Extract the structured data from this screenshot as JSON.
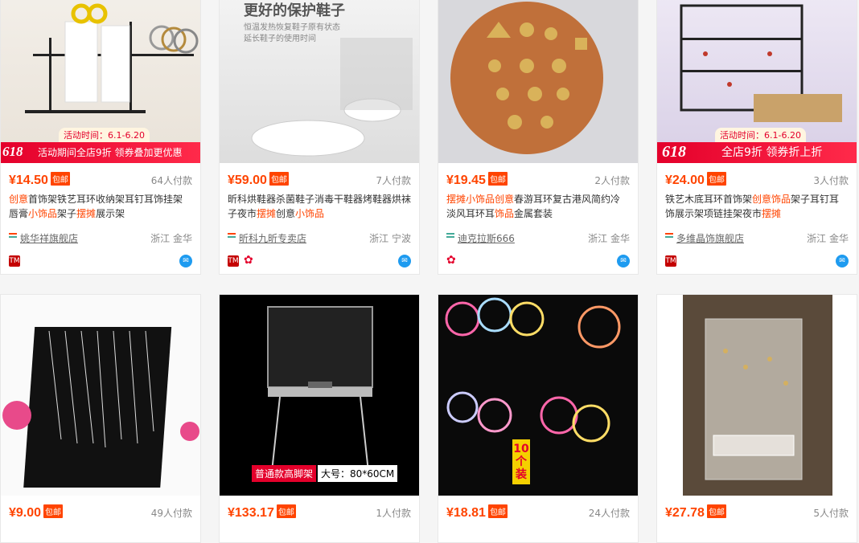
{
  "products": [
    {
      "price": "¥14.50",
      "badge": "包邮",
      "sales": "64人付款",
      "title_parts": [
        "创意",
        "首饰架铁艺耳环收纳架耳钉耳饰挂架唇膏",
        "小饰品",
        "架子",
        "摆摊",
        "展示架"
      ],
      "shop": "姚华祥旗舰店",
      "location": "浙江 金华",
      "promo_time": "活动时间：6.1-6.20",
      "promo_text": "活动期间全店9折 领券叠加更优惠",
      "promo_tag": "618",
      "image": "jewelry-rack-with-bracelets"
    },
    {
      "price": "¥59.00",
      "badge": "包邮",
      "sales": "7人付款",
      "title_parts": [
        "昕科烘鞋器杀菌鞋子消毒干鞋器烤鞋器烘袜子夜市",
        "摆摊",
        "创意",
        "小饰品",
        "",
        ""
      ],
      "shop": "昕科九昕专卖店",
      "location": "浙江 宁波",
      "overlay_title": "更好的保护鞋子",
      "overlay_sub1": "恒温发热恢复鞋子原有状态",
      "overlay_sub2": "延长鞋子的使用时间",
      "image": "shoe-dryer"
    },
    {
      "price": "¥19.45",
      "badge": "包邮",
      "sales": "2人付款",
      "title_parts": [
        "摆摊",
        "小饰品",
        "创意",
        "春游耳环复古港风简约冷淡风耳环耳",
        "饰品",
        "金属套装"
      ],
      "shop": "迪克拉斯666",
      "location": "浙江 金华",
      "image": "gold-earrings"
    },
    {
      "price": "¥24.00",
      "badge": "包邮",
      "sales": "3人付款",
      "title_parts": [
        "铁艺木底耳环首饰架",
        "创意",
        "饰品",
        "架子耳钉耳饰展示架项链挂架夜市",
        "摆摊",
        ""
      ],
      "shop": "多维晶饰旗舰店",
      "location": "浙江 金华",
      "promo_time": "活动时间：6.1-6.20",
      "promo_text": "全店9折 领券折上折",
      "promo_tag": "618",
      "image": "earring-display-stand"
    },
    {
      "price": "¥9.00",
      "badge": "包邮",
      "sales": "49人付款",
      "image": "necklace-board"
    },
    {
      "price": "¥133.17",
      "badge": "包邮",
      "sales": "1人付款",
      "image": "display-case-table",
      "overlay_a": "普通款高脚架",
      "overlay_b": "大号：80*60CM"
    },
    {
      "price": "¥18.81",
      "badge": "包邮",
      "sales": "24人付款",
      "image": "light-up-balloons",
      "overlay_c": "10个装"
    },
    {
      "price": "¥27.78",
      "badge": "包邮",
      "sales": "5人付款",
      "image": "acrylic-jewelry-box"
    }
  ],
  "colors": {
    "price": "#ff4400",
    "promo": "#e4002b",
    "wangwang": "#1e9bf0",
    "tmall": "#c40000"
  }
}
